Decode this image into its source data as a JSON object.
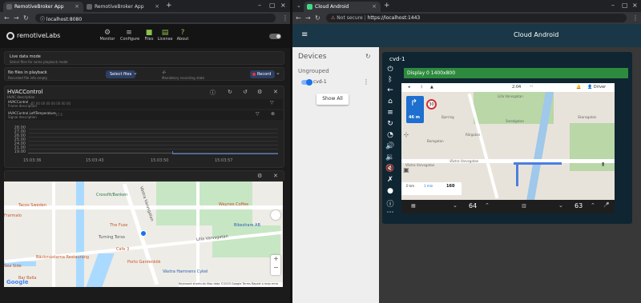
{
  "left_browser": {
    "tabs": [
      {
        "title": "RemotiveBroker App"
      },
      {
        "title": "RemotiveBroker App"
      }
    ],
    "url": "localhost:8080"
  },
  "remotive": {
    "logo": "remotiveLabs",
    "nav": [
      {
        "label": "Monitor",
        "icon": "monitor-icon"
      },
      {
        "label": "Configure",
        "icon": "sliders-icon"
      },
      {
        "label": "Files",
        "icon": "folder-icon"
      },
      {
        "label": "License",
        "icon": "license-icon"
      },
      {
        "label": "About",
        "icon": "help-icon"
      }
    ],
    "live_mode": {
      "title": "Live data mode",
      "subtitle": "Select files for some playback mode"
    },
    "playback": {
      "title": "No files in playback",
      "subtitle": "Recorded file info empty",
      "select_label": "Select files",
      "time": "-/-",
      "time_sub": "Mandatory recording state",
      "record_label": "Record"
    },
    "hvac": {
      "title": "HVACControl",
      "subtitle": "HVAC description",
      "rows": [
        {
          "name": "HVACControl",
          "sub": "Frame description",
          "value": "-87 00 00 00 00 00 00 00"
        },
        {
          "name": "HVACControl.LeftTemperature",
          "sub": "Signal description",
          "value": "17.5"
        }
      ],
      "y_ticks": [
        "28.00",
        "27.00",
        "26.00",
        "25.00",
        "24.00",
        "23.00",
        "22.00",
        "21.00",
        "20.00",
        "19.00"
      ],
      "x_ticks": [
        "15:03:36",
        "15:03:43",
        "15:03:50",
        "15:03:57"
      ]
    },
    "map": {
      "pois": [
        "Crossfit/Banken",
        "Tacos Sweden",
        "The Fuse",
        "Turning Torso",
        "Porto Gardenkök",
        "Sea Side",
        "Bar Bella",
        "Bäckmästarna Restaurang",
        "Cafe 3",
        "Waynes Coffee",
        "Bikeshare AB",
        "Västra Hamnens Cykel",
        "Lilla Varvsgatan",
        "Västra Varvsgatan",
        "Frarmalo"
      ],
      "attribution": [
        "Keyboard shortcuts",
        "Map data ©2025 Google",
        "Terms",
        "Report a map error"
      ],
      "brand": "Google"
    }
  },
  "right_browser": {
    "tab": "Cloud Android",
    "security": "Not secure",
    "url": "https://localhost:1443"
  },
  "cloud_android": {
    "title": "Cloud Android",
    "devices_header": "Devices",
    "group": "Ungrouped",
    "device_name": "cvd-1",
    "show_all": "Show All",
    "device_title": "cvd-1",
    "display_label": "Display 0 1400x800",
    "nav_ui": {
      "time": "2:04",
      "driver": "Driver",
      "distance": "46 m",
      "speed_limit": "30",
      "eta": [
        "0 km",
        "1 min",
        "160"
      ],
      "streets": [
        "Lilla Varvsgatan",
        "Västra Varvsgatan",
        "Bjerring",
        "Bomgatan",
        "Rörgatan",
        "Smedgatan",
        "Skansgatan"
      ],
      "temp_left": "64",
      "temp_right": "63"
    }
  },
  "colors": {
    "accent_blue": "#1a73e8",
    "header_teal": "#1a3747",
    "display_green": "#2e8b3e"
  }
}
